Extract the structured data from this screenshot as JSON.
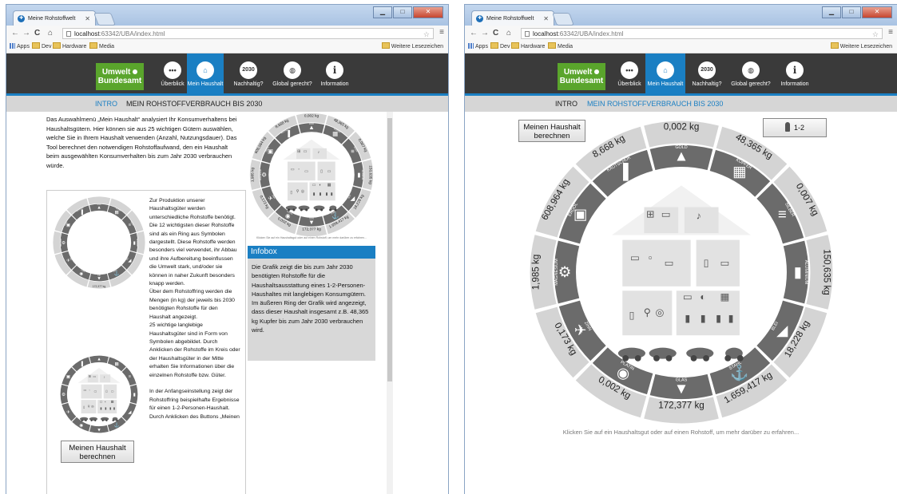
{
  "browser": {
    "tab_title": "Meine Rohstoffwelt",
    "url_host": "localhost",
    "url_path": ":63342/UBA/index.html",
    "bookmarks": [
      "Apps",
      "Dev",
      "Hardware",
      "Media"
    ],
    "other_bookmarks": "Weitere Lesezeichen"
  },
  "logo": {
    "line1": "Umwelt",
    "line2": "Bundesamt"
  },
  "nav": [
    {
      "label": "Überblick",
      "glyph": "•••"
    },
    {
      "label": "Mein Haushalt",
      "glyph": "⌂"
    },
    {
      "label": "Nachhaltig?",
      "glyph": "2030"
    },
    {
      "label": "Global gerecht?",
      "glyph": "◍"
    },
    {
      "label": "Information",
      "glyph": "i"
    }
  ],
  "subnav": {
    "intro": "INTRO",
    "page": "MEIN ROHSTOFFVERBRAUCH BIS 2030"
  },
  "intro_text": "Das Auswahlmenü „Mein Haushalt“ analysiert Ihr Konsumverhaltens bei Haushaltsgütern. Hier können sie aus 25 wichtigen Gütern auswählen, welche Sie in Ihrem Haushalt verwenden (Anzahl, Nutzungsdauer). Das Tool berechnet den notwendigen Rohstoffaufwand, den ein Haushalt beim ausgewählten Konsumverhalten bis zum Jahr 2030 verbrauchen würde.",
  "guide": {
    "p1": "Zur Produktion unserer Haushaltsgüter werden unterschiedliche Rohstoffe benötigt. Die 12 wichtigsten dieser Rohstoffe sind als ein Ring aus Symbolen dargestellt. Diese Rohstoffe werden besonders viel verwendet, ihr Abbau und ihre Aufbereitung beeinflussen die Umwelt stark, und/oder sie können in naher Zukunft besonders knapp werden.",
    "p2": "Über dem Rohstoffring werden die Mengen (in kg) der jeweils bis 2030 benötigten Rohstoffe für den Haushalt angezeigt.",
    "p3": "25 wichtige langlebige Haushaltsgüter sind in Form von Symbolen abgebildet. Durch Anklicken der Rohstoffe im Kreis oder der Haushaltsgüter in der Mitte erhalten Sie Informationen über die einzelnen Rohstoffe bzw. Güter.",
    "p4": "In der Anfangseinstellung zeigt der Rohstoffring beispielhafte Ergebnisse für einen 1-2-Personen-Haushalt. Durch Anklicken des Buttons „Meinen",
    "ring_label": "172,377 kg"
  },
  "infobox": {
    "title": "Infobox",
    "text": "Die Grafik zeigt die bis zum Jahr 2030 benötigten Rohstoffe für die Haushaltsausstattung eines 1-2-Personen-Haushaltes mit langlebigen Konsumgütern. Im äußeren Ring der Grafik wird angezeigt, dass dieser Haushalt insgesamt z.B. 48,365 kg Kupfer bis zum Jahr 2030 verbrauchen wird."
  },
  "buttons": {
    "calc_line1": "Meinen Haushalt",
    "calc_line2": "berechnen",
    "persons": "1-2"
  },
  "ring": {
    "materials": [
      {
        "name": "GOLD",
        "kg": "0,002 kg"
      },
      {
        "name": "KUPFER",
        "kg": "48,365 kg"
      },
      {
        "name": "SILBER",
        "kg": "0,007 kg"
      },
      {
        "name": "ALUMINIUM",
        "kg": "150,635 kg"
      },
      {
        "name": "BLEI",
        "kg": "18,228 kg"
      },
      {
        "name": "STAHL",
        "kg": "1.659,417 kg"
      },
      {
        "name": "GLAS",
        "kg": "172,377 kg"
      },
      {
        "name": "PLATIN",
        "kg": "0,002 kg"
      },
      {
        "name": "ZINN",
        "kg": "0,173 kg"
      },
      {
        "name": "MAGNESIUM",
        "kg": "1,985 kg"
      },
      {
        "name": "ERDÖL",
        "kg": "608,964 kg"
      },
      {
        "name": "KAUTSCHUK",
        "kg": "8,668 kg"
      }
    ],
    "caption": "Klicken Sie auf ein Haushaltsgut oder auf einen Rohstoff, um mehr darüber zu erfahren..."
  },
  "colors": {
    "header": "#3a3a3a",
    "accent": "#1a7fc3",
    "logo": "#5aa52c",
    "ring_dark": "#6b6b6b",
    "ring_light": "#d4d4d4"
  }
}
